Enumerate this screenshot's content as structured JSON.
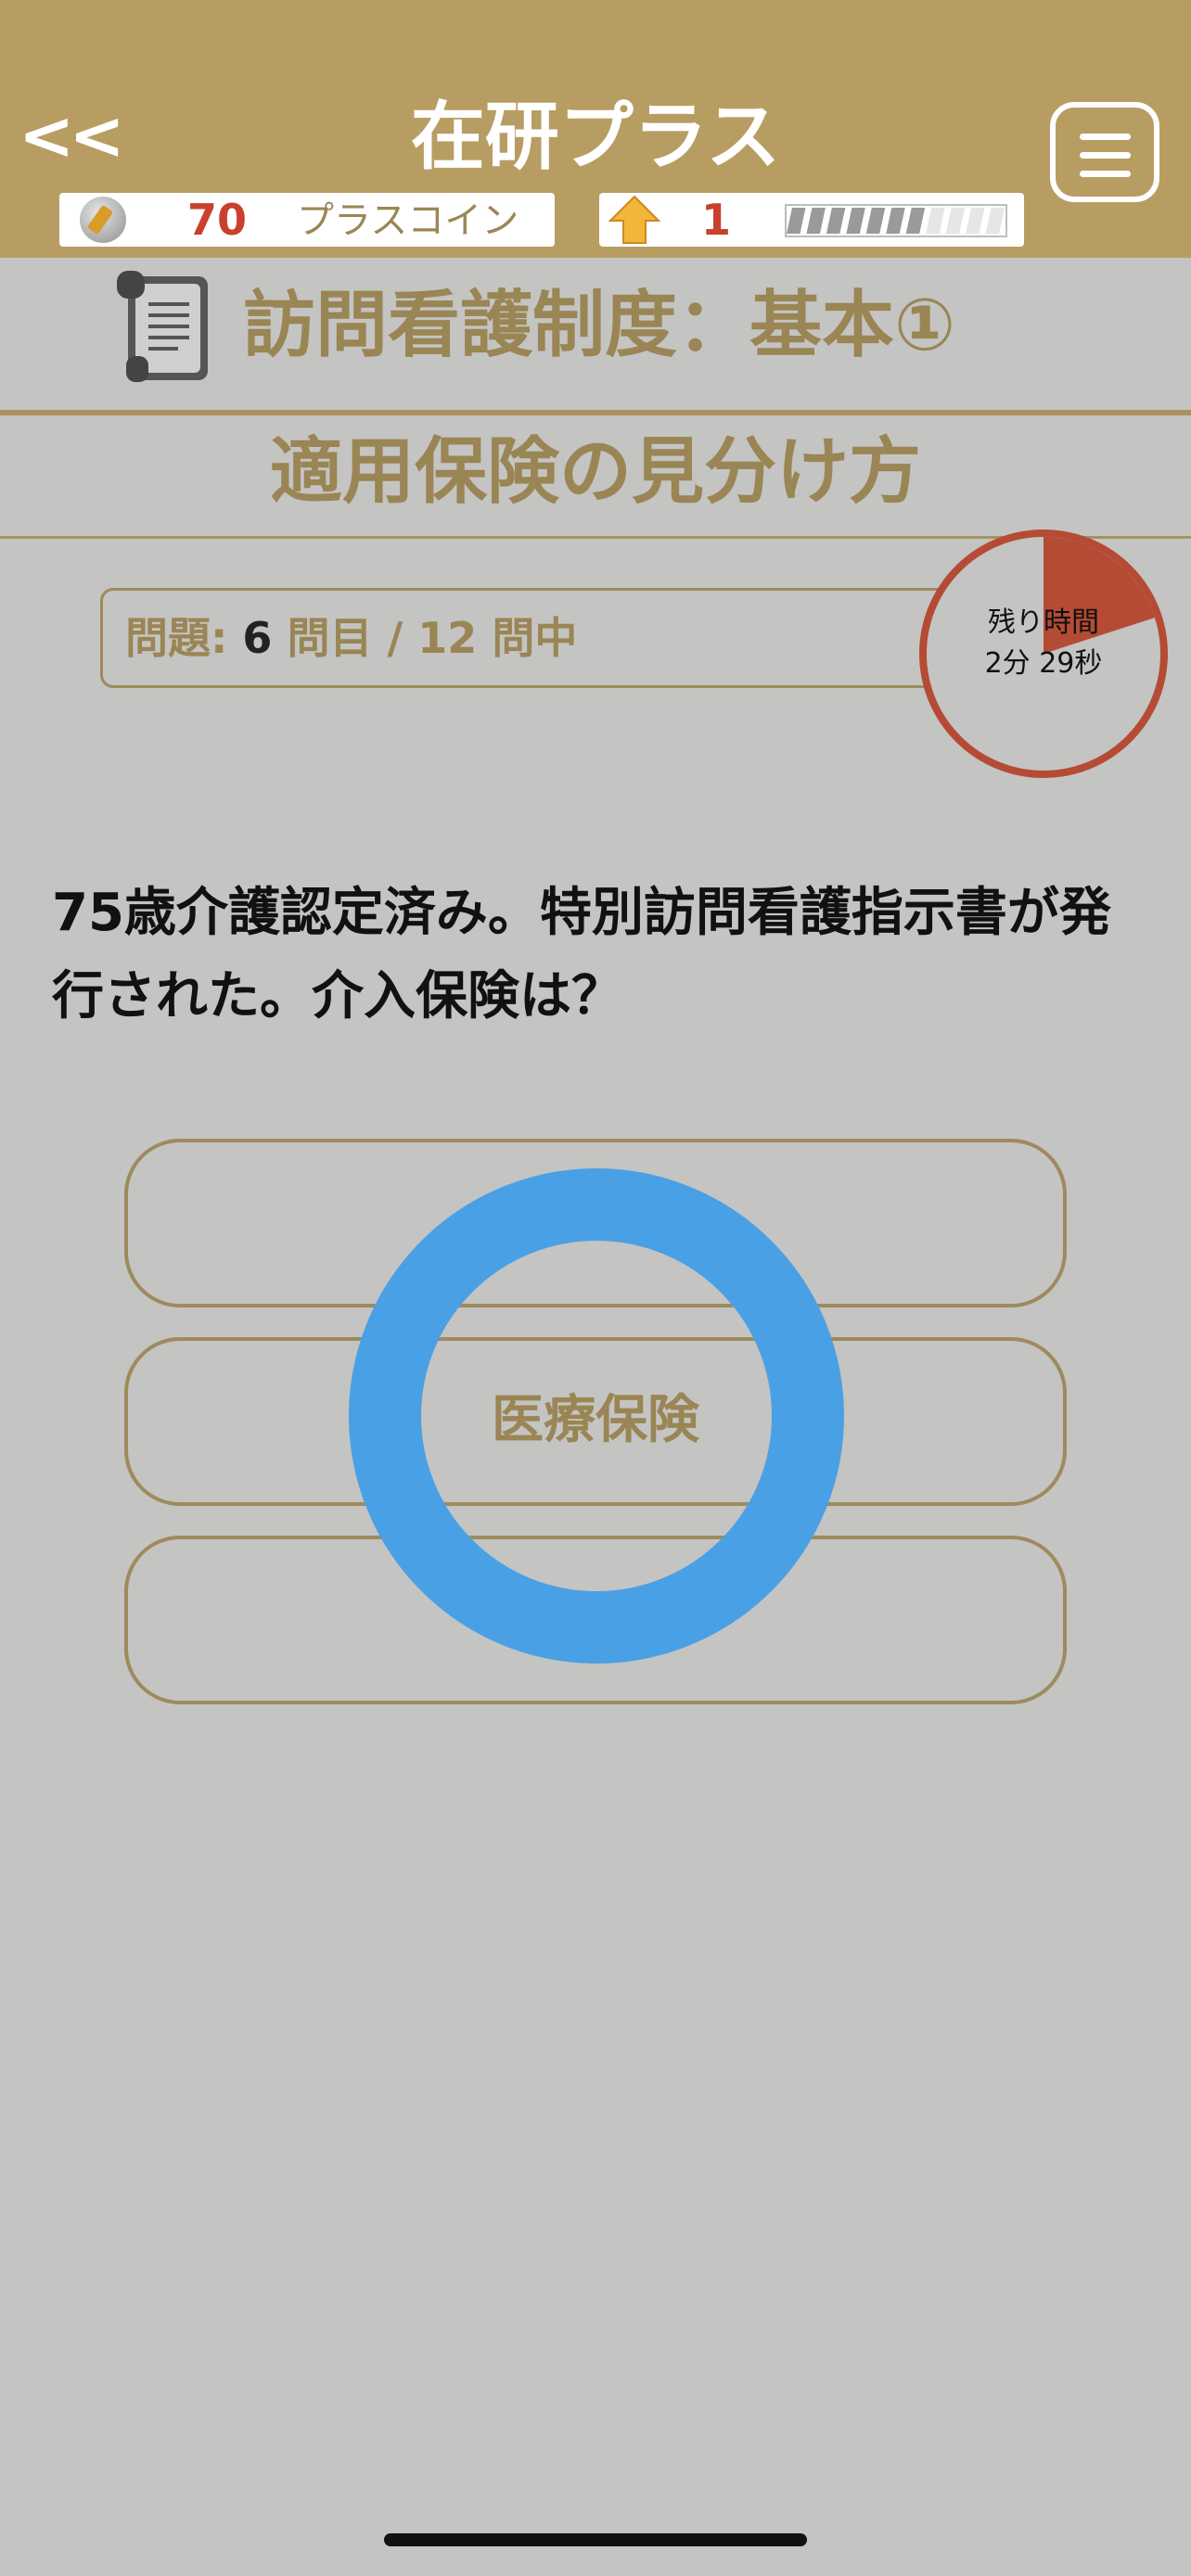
{
  "header": {
    "back_label": "<<",
    "app_title": "在研プラス",
    "menu_icon": "hamburger-menu-icon"
  },
  "status": {
    "coin_value": "70",
    "coin_label": "プラスコイン",
    "level_value": "1",
    "level_progress_segments_filled": 7,
    "level_progress_segments_total": 11
  },
  "section": {
    "title": "訪問看護制度：基本①",
    "subtitle": "適用保険の見分け方"
  },
  "quiz": {
    "label_prefix": "問題: ",
    "current": "6",
    "label_mid": " 問目 / ",
    "total": "12",
    "label_suffix": " 問中",
    "timer_label": "残り時間",
    "timer_value": "2分 29秒",
    "timer_elapsed_fraction": 0.2,
    "question": "75歳介護認定済み。特別訪問看護指示書が発行された。介入保険は？",
    "answers": [
      "",
      "医療保険",
      ""
    ],
    "feedback": "correct-circle"
  },
  "colors": {
    "header_bg": "#b89d63",
    "accent_text": "#9a8554",
    "alert_red": "#c9402c",
    "timer_red": "#b54b35",
    "feedback_blue": "#4aa0e4",
    "page_bg": "#c4c4c3"
  }
}
